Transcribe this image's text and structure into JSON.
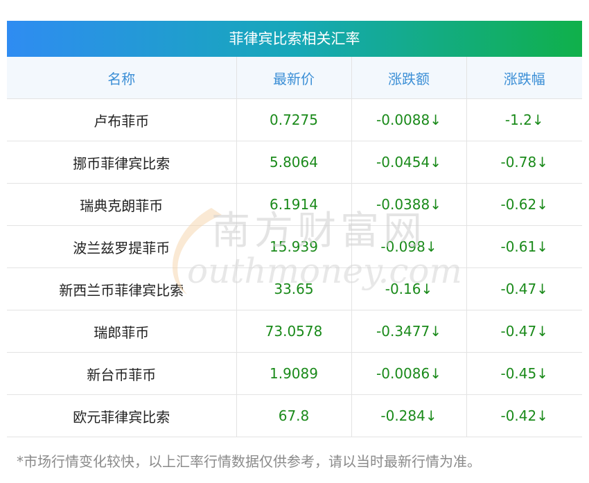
{
  "title": "菲律宾比索相关汇率",
  "headers": [
    "名称",
    "最新价",
    "涨跌额",
    "涨跌幅"
  ],
  "rows": [
    {
      "name": "卢布菲币",
      "price": "0.7275",
      "change": "-0.0088↓",
      "pct": "-1.2↓"
    },
    {
      "name": "挪币菲律宾比索",
      "price": "5.8064",
      "change": "-0.0454↓",
      "pct": "-0.78↓"
    },
    {
      "name": "瑞典克朗菲币",
      "price": "6.1914",
      "change": "-0.0388↓",
      "pct": "-0.62↓"
    },
    {
      "name": "波兰兹罗提菲币",
      "price": "15.939",
      "change": "-0.098↓",
      "pct": "-0.61↓"
    },
    {
      "name": "新西兰币菲律宾比索",
      "price": "33.65",
      "change": "-0.16↓",
      "pct": "-0.47↓"
    },
    {
      "name": "瑞郎菲币",
      "price": "73.0578",
      "change": "-0.3477↓",
      "pct": "-0.47↓"
    },
    {
      "name": "新台币菲币",
      "price": "1.9089",
      "change": "-0.0086↓",
      "pct": "-0.45↓"
    },
    {
      "name": "欧元菲律宾比索",
      "price": "67.8",
      "change": "-0.284↓",
      "pct": "-0.42↓"
    }
  ],
  "footnote": "*市场行情变化较快，以上汇率行情数据仅供参考，请以当时最新行情为准。",
  "watermark": {
    "cn": "南方财富网",
    "en": "outhmoney.com"
  },
  "colors": {
    "header_text": "#3c8fd6",
    "value_green": "#1a8a1a",
    "gradient_start": "#2f8cf2",
    "gradient_end": "#10b04a"
  }
}
